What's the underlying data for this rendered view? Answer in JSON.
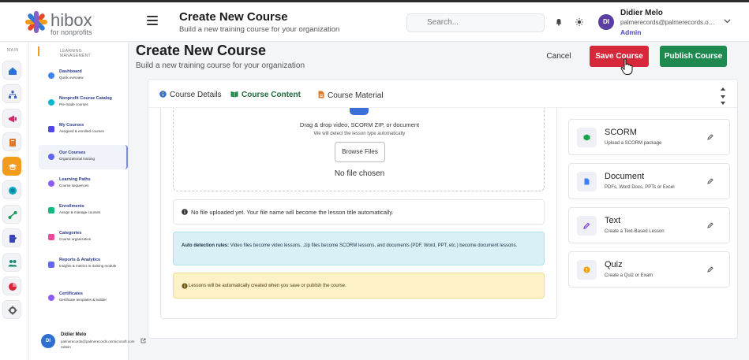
{
  "header": {
    "title": "Create New Course",
    "subtitle": "Build a new training course for your organization",
    "search_placeholder": "Search...",
    "user": {
      "initials": "DI",
      "name": "Didier Melo",
      "email": "palmerecords@palmerecords.onmicrosoft.com",
      "role": "Admin"
    }
  },
  "rail": {
    "section_label": "MAIN"
  },
  "nav": {
    "heading_line1": "LEARNING",
    "heading_line2": "MANAGEMENT",
    "items": [
      {
        "title": "Dashboard",
        "sub": "Quick overview",
        "color": "#3b82f6"
      },
      {
        "title": "Nonprofit Course Catalog",
        "sub": "Pre-made courses",
        "color": "#06b6d4"
      },
      {
        "title": "My Courses",
        "sub": "Assigned & enrolled courses",
        "color": "#4f46e5"
      },
      {
        "title": "Our Courses",
        "sub": "Organizational training",
        "color": "#6366f1"
      },
      {
        "title": "Learning Paths",
        "sub": "Course sequences",
        "color": "#8b5cf6"
      },
      {
        "title": "Enrollments",
        "sub": "Assign & manage courses",
        "color": "#10b981"
      },
      {
        "title": "Categories",
        "sub": "Course organization",
        "color": "#ec4899"
      },
      {
        "title": "Reports & Analytics",
        "sub": "Insights & metrics in training module",
        "color": "#6366f1"
      },
      {
        "title": "Certificates",
        "sub": "Certificate templates & builder",
        "color": "#8b5cf6"
      }
    ],
    "user": {
      "initials": "DI",
      "name": "Didier Melo",
      "email": "palmerecords@palmerecords.onmicrosoft.com",
      "role": "Admin"
    }
  },
  "main": {
    "title": "Create New Course",
    "subtitle": "Build a new training course for your organization",
    "cancel_label": "Cancel",
    "save_label": "Save Course",
    "publish_label": "Publish Course",
    "tabs": [
      {
        "label": "Course Details"
      },
      {
        "label": "Course Content"
      },
      {
        "label": "Course Material"
      }
    ],
    "dropzone": {
      "line1": "Drag & drop video, SCORM ZIP, or document",
      "line2": "We will detect the lesson type automatically",
      "browse_label": "Browse Files",
      "no_file": "No file chosen"
    },
    "info_text": "No file uploaded yet. Your file name will become the lesson title automatically.",
    "auto_label": "Auto detection rules:",
    "auto_text": "Video files become video lessons, .zip files become SCORM lessons, and documents (PDF, Word, PPT, etc.) become document lessons.",
    "warn_text": "Lessons will be automatically created when you save or publish the course.",
    "material_types": [
      {
        "title": "SCORM",
        "sub": "Upload a SCORM package",
        "icon": "package-icon",
        "color": "#16a34a"
      },
      {
        "title": "Document",
        "sub": "PDFs, Word Docs, PPTs or Excel",
        "icon": "document-icon",
        "color": "#3b82f6"
      },
      {
        "title": "Text",
        "sub": "Create a Text-Based Lesson",
        "icon": "pencil-icon",
        "color": "#7c3aed"
      },
      {
        "title": "Quiz",
        "sub": "Create a Quiz or Exam",
        "icon": "quiz-icon",
        "color": "#f59e0b"
      }
    ]
  },
  "colors": {
    "accent": "#f39b1c",
    "save": "#d6283a",
    "publish": "#1f8a4f"
  }
}
